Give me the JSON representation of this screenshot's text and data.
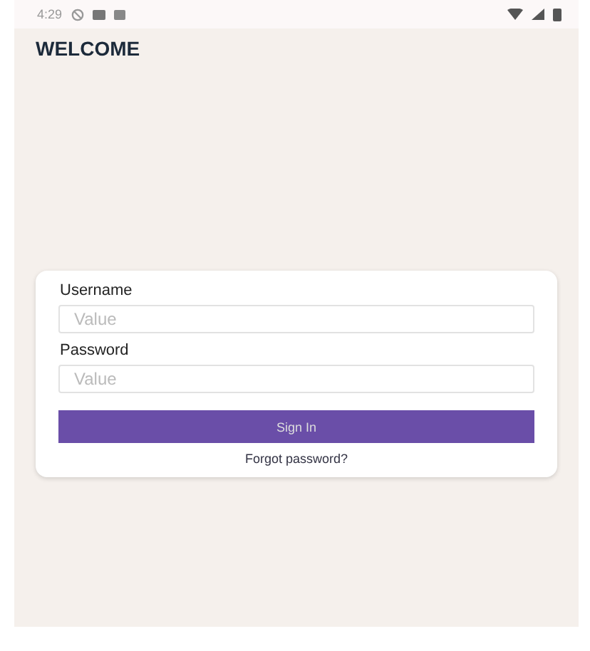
{
  "status_bar": {
    "time": "4:29"
  },
  "title": "WELCOME",
  "form": {
    "fields": [
      {
        "label": "Username",
        "placeholder": "Value"
      },
      {
        "label": "Password",
        "placeholder": "Value"
      }
    ],
    "button": "Sign In",
    "link": "Forgot password?"
  }
}
